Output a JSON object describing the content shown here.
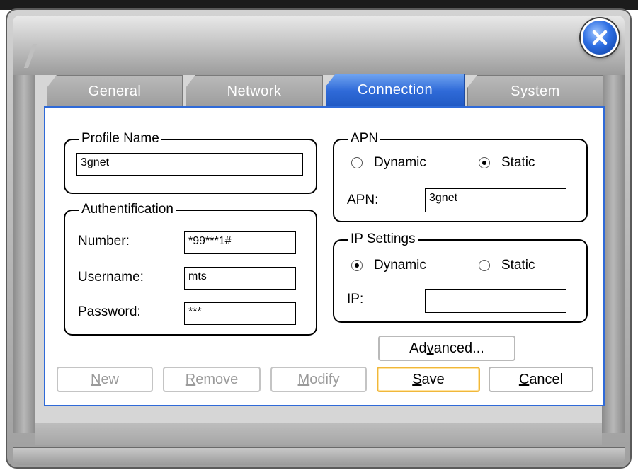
{
  "tabs": [
    {
      "label": "General",
      "active": false
    },
    {
      "label": "Network",
      "active": false
    },
    {
      "label": "Connection",
      "active": true
    },
    {
      "label": "System",
      "active": false
    }
  ],
  "profile": {
    "legend": "Profile Name",
    "value": "3gnet"
  },
  "auth": {
    "legend": "Authentification",
    "number_label": "Number:",
    "number_value": "*99***1#",
    "username_label": "Username:",
    "username_value": "mts",
    "password_label": "Password:",
    "password_value": "***"
  },
  "apn": {
    "legend": "APN",
    "dynamic_label": "Dynamic",
    "static_label": "Static",
    "selected": "static",
    "apn_label": "APN:",
    "apn_value": "3gnet"
  },
  "ip": {
    "legend": "IP Settings",
    "dynamic_label": "Dynamic",
    "static_label": "Static",
    "selected": "dynamic",
    "ip_label": "IP:",
    "ip_value": ""
  },
  "buttons": {
    "advanced": {
      "pre": "Ad",
      "acc": "v",
      "post": "anced..."
    },
    "new": {
      "acc": "N",
      "post": "ew"
    },
    "remove": {
      "acc": "R",
      "post": "emove"
    },
    "modify": {
      "acc": "M",
      "post": "odify"
    },
    "save": {
      "acc": "S",
      "post": "ave"
    },
    "cancel": {
      "acc": "C",
      "post": "ancel"
    }
  },
  "colors": {
    "active_tab": "#2f6ad8",
    "default_button_border": "#f0b73a",
    "close_button": "#2e6fe3"
  },
  "icons": {
    "close": "close-x-icon"
  }
}
